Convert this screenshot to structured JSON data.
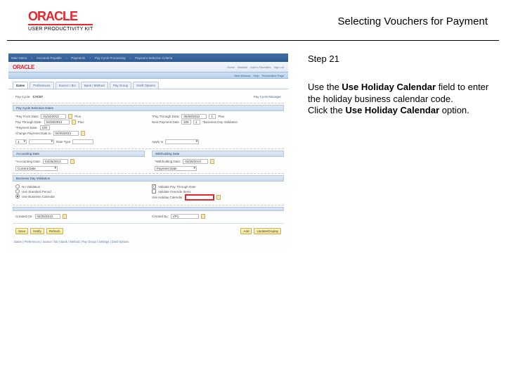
{
  "brand": {
    "name": "ORACLE",
    "product": "USER PRODUCTIVITY KIT"
  },
  "page": {
    "title": "Selecting Vouchers for Payment"
  },
  "instructions": {
    "step": "Step 21",
    "line1a": "Use the ",
    "line1b": "Use Holiday Calendar",
    "line1c": " field to enter the holiday business calendar code.",
    "line2a": "Click the ",
    "line2b": "Use Holiday Calendar",
    "line2c": " option."
  },
  "app": {
    "topbar": [
      "Main Menu",
      "Accounts Payable",
      "Payments",
      "Pay Cycle Processing",
      "Payment Selection Criteria"
    ],
    "logo": "ORACLE",
    "links": [
      "Home",
      "Worklist",
      "Add to Favorites",
      "Sign out"
    ],
    "bluebar": [
      "New Window",
      "Help",
      "Personalize Page"
    ],
    "tabs": [
      "Dates",
      "Preferences",
      "Source / BU",
      "Bank / Method",
      "Pay Group",
      "Draft Options"
    ],
    "paycycle": {
      "label": "Pay Cycle:",
      "value": "CYC07",
      "mgr_label": "Pay Cycle Manager"
    },
    "selection_dates": {
      "header": "Pay Cycle Selection Dates",
      "pay_from_lbl": "*Pay From Date:",
      "pay_from": "01/24/2013",
      "pay_through_lbl": "*Pay Through Date:",
      "pay_through": "05/08/2013",
      "next_pay_through": "1",
      "plus_lbl": "Plus",
      "payment_lbl": "*Payment Date:",
      "payment": "04/25/2013",
      "next_payment": "1",
      "business_lbl": "*Business Day Validation",
      "business": "100",
      "change_lbl": "Change Payment Date to"
    },
    "currency": {
      "rate_type_lbl": "Rate Type",
      "apply_lbl": "Apply to"
    },
    "accounting": {
      "header": "Accounting Date",
      "acct_lbl": "*Accounting Date:",
      "acct": "04/25/2013",
      "wh_header": "Withholding Date",
      "wh_lbl": "*Withholding Date:",
      "wh": "04/25/2013",
      "type_val": "Current Date",
      "wh_type": "Payment Date"
    },
    "bdv": {
      "header": "Business Day Validation",
      "opts": [
        "No Validation",
        "Use Standard Period",
        "Use Business Calendar"
      ],
      "chk1": "Validate Pay Through Date",
      "chk2": "Validate Override Items",
      "cal_lbl": "Use Holiday Calendar"
    },
    "created": {
      "header": "",
      "created_lbl": "Created On:",
      "created": "04/25/2013",
      "by_lbl": "Created By:",
      "by": "VP1"
    },
    "buttons": {
      "save": "Save",
      "notify": "Notify",
      "refresh": "Refresh",
      "add": "Add",
      "update": "Update/Display"
    },
    "footer": "Dates | Preferences | Source / BU | Bank / Method | Pay Group | Settings | Draft Options"
  }
}
